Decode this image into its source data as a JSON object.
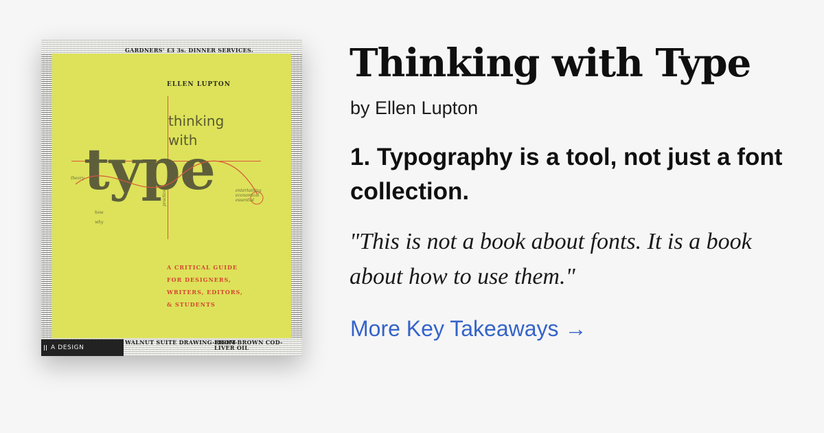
{
  "book": {
    "title": "Thinking with Type",
    "byline": "by Ellen Lupton"
  },
  "takeaway": {
    "heading": "1. Typography is a tool, not just a font collection.",
    "quote": "\"This is not a book about fonts. It is a book about how to use them.\""
  },
  "link": {
    "label": "More Key Takeaways →"
  },
  "cover": {
    "author": "ELLEN LUPTON",
    "title_line1": "thinking",
    "title_line2": "with",
    "title_big": "type",
    "label_theory": "theory",
    "label_practice": "practice",
    "label_entertaining": "entertaining",
    "label_economical": "economical",
    "label_essential": "essential",
    "label_how": "how",
    "label_why": "why",
    "subtitle_line1": "A CRITICAL GUIDE",
    "subtitle_line2": "FOR DESIGNERS,",
    "subtitle_line3": "WRITERS, EDITORS,",
    "subtitle_line4": "& STUDENTS",
    "series": "A DESIGN HANDBOOK",
    "news_top": "GARDNERS' £3 3s. DINNER SERVICES.",
    "news_bottom_left": "WALNUT SUITE DRAWING-ROOM",
    "news_bottom_right": "LIGHT-BROWN COD-LIVER OIL",
    "accent_color": "#dde25a",
    "highlight_color": "#d54430"
  }
}
